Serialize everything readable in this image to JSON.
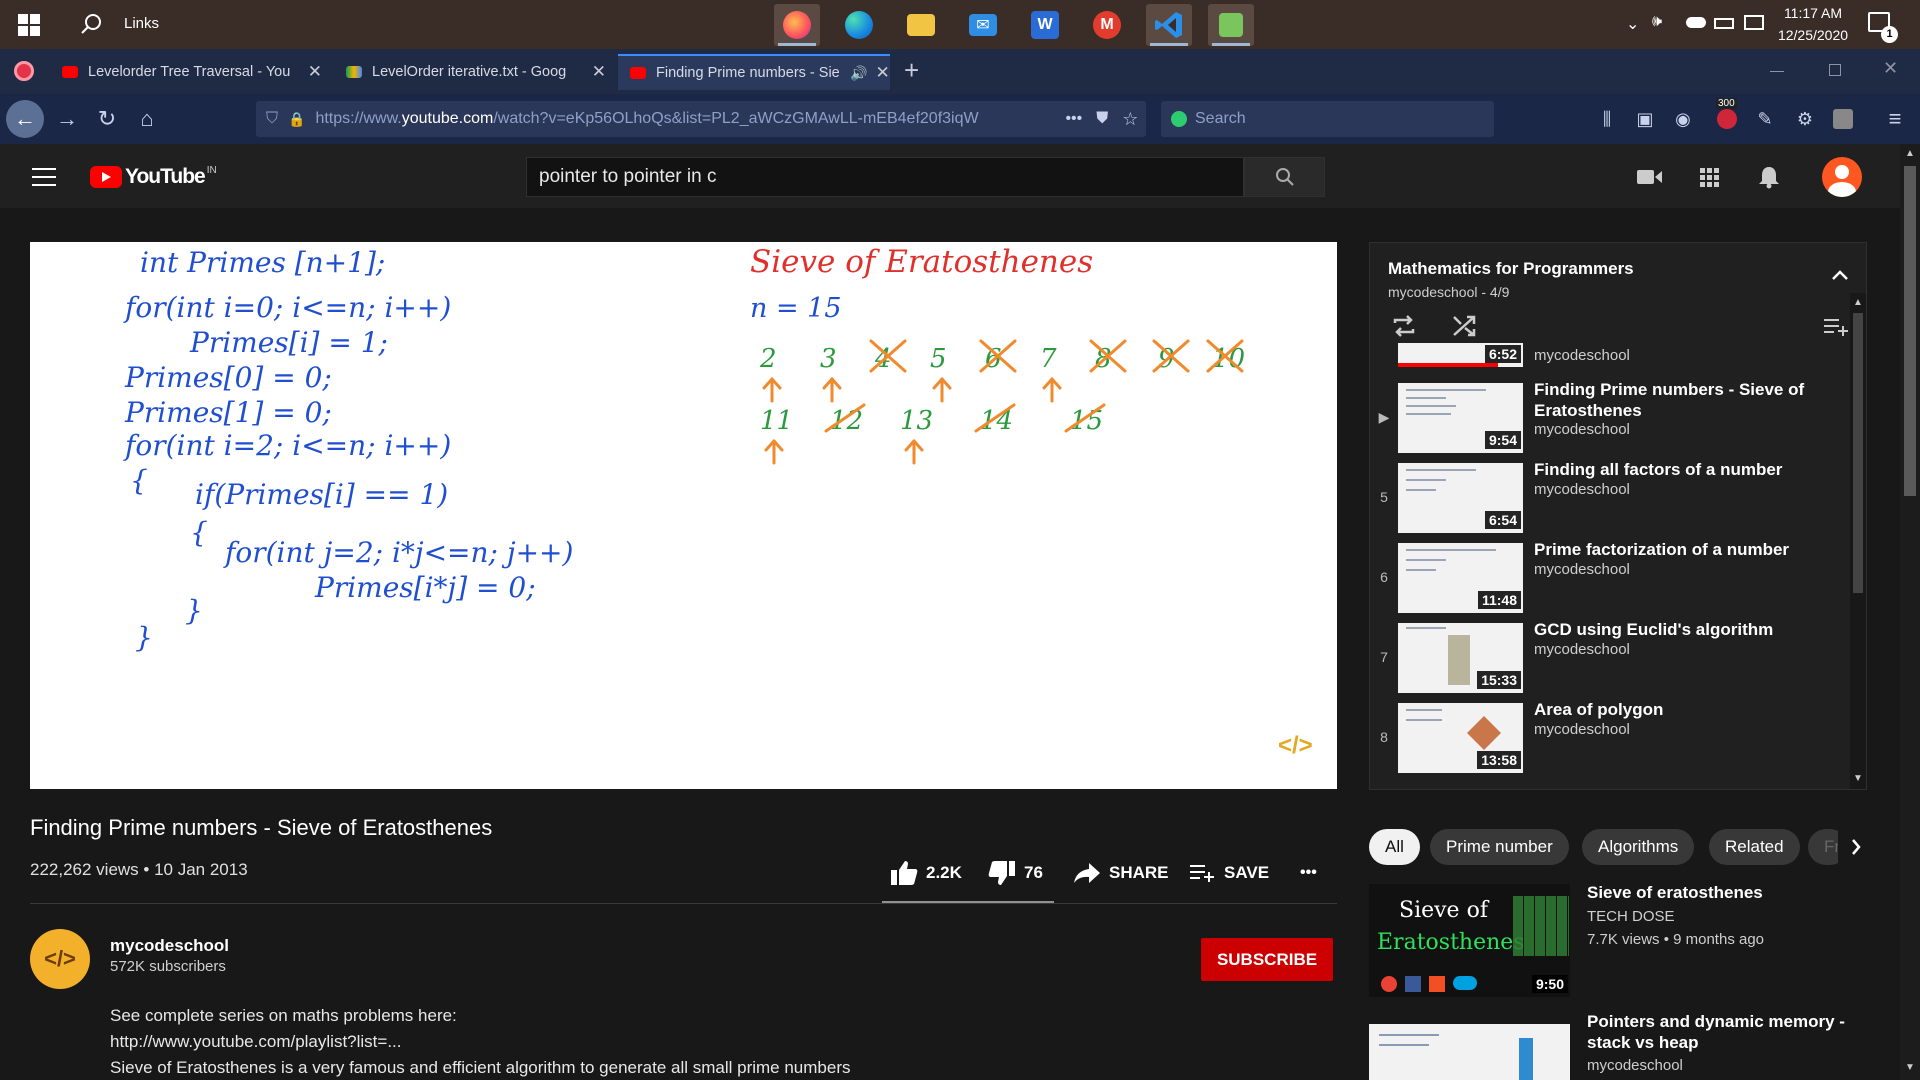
{
  "taskbar": {
    "search_label": "Links",
    "clock_time": "11:17 AM",
    "clock_date": "12/25/2020",
    "notification_count": "1"
  },
  "browser": {
    "tabs": [
      {
        "title": "Levelorder Tree Traversal - You",
        "favicon_color": "#ff0000"
      },
      {
        "title": "LevelOrder iterative.txt - Goog",
        "favicon_color": "#f4b400"
      },
      {
        "title": "Finding Prime numbers - Sie",
        "favicon_color": "#ff0000"
      }
    ],
    "new_tab": "+",
    "url_prefix": "https://www.",
    "url_domain": "youtube.com",
    "url_rest": "/watch?v=eKp56OLhoQs&list=PL2_aWCzGMAwLL-mEB4ef20f3iqW",
    "search_placeholder": "Search",
    "pocket_badge": "300"
  },
  "youtube": {
    "logo": "YouTube",
    "region": "IN",
    "search_query": "pointer to pointer in c"
  },
  "video_frame": {
    "code_lines": [
      "int  Primes [n+1];",
      "for(int i=0; i<=n; i++)",
      "Primes[i] = 1;",
      "Primes[0] = 0;",
      "Primes[1] = 0;",
      "for(int  i=2; i<=n; i++)",
      "{",
      "if(Primes[i] == 1)",
      "{",
      "for(int j=2; i*j<=n; j++)",
      "Primes[i*j] = 0;",
      "}",
      "}"
    ],
    "heading": "Sieve  of  Eratosthenes",
    "n_label": "n = 15",
    "row1": [
      "2",
      "3",
      "4",
      "5",
      "6",
      "7",
      "8",
      "9",
      "10"
    ],
    "row2": [
      "11",
      "12",
      "13",
      "14",
      "15"
    ],
    "watermark": "</>"
  },
  "video": {
    "title": "Finding Prime numbers - Sieve of Eratosthenes",
    "views_date": "222,262 views • 10 Jan 2013",
    "likes": "2.2K",
    "dislikes": "76",
    "share": "SHARE",
    "save": "SAVE",
    "more": "•••"
  },
  "channel": {
    "name": "mycodeschool",
    "subscribers": "572K subscribers",
    "subscribe": "SUBSCRIBE",
    "avatar_text": "</>"
  },
  "description": [
    "See complete series on maths problems here:",
    "http://www.youtube.com/playlist?list=...",
    "Sieve of Eratosthenes is a very famous and efficient algorithm to generate all small prime numbers"
  ],
  "playlist": {
    "title": "Mathematics for Programmers",
    "subtitle": "mycodeschool - 4/9",
    "items": [
      {
        "index": "",
        "duration": "6:52",
        "title": "",
        "channel": "mycodeschool"
      },
      {
        "index": "▶",
        "duration": "9:54",
        "title": "Finding Prime numbers - Sieve of Eratosthenes",
        "channel": "mycodeschool"
      },
      {
        "index": "5",
        "duration": "6:54",
        "title": "Finding all factors of a number",
        "channel": "mycodeschool"
      },
      {
        "index": "6",
        "duration": "11:48",
        "title": "Prime factorization of a number",
        "channel": "mycodeschool"
      },
      {
        "index": "7",
        "duration": "15:33",
        "title": "GCD using Euclid's algorithm",
        "channel": "mycodeschool"
      },
      {
        "index": "8",
        "duration": "13:58",
        "title": "Area of polygon",
        "channel": "mycodeschool"
      }
    ]
  },
  "chips": [
    "All",
    "Prime number",
    "Algorithms",
    "Related",
    "Fr"
  ],
  "recommendations": [
    {
      "title": "Sieve of eratosthenes",
      "channel": "TECH DOSE",
      "meta": "7.7K views • 9 months ago",
      "duration": "9:50",
      "thumb_text_1": "Sieve of",
      "thumb_text_2": "Eratosthenes"
    },
    {
      "title": "Pointers and dynamic memory - stack vs heap",
      "channel": "mycodeschool",
      "meta": "",
      "duration": ""
    }
  ]
}
